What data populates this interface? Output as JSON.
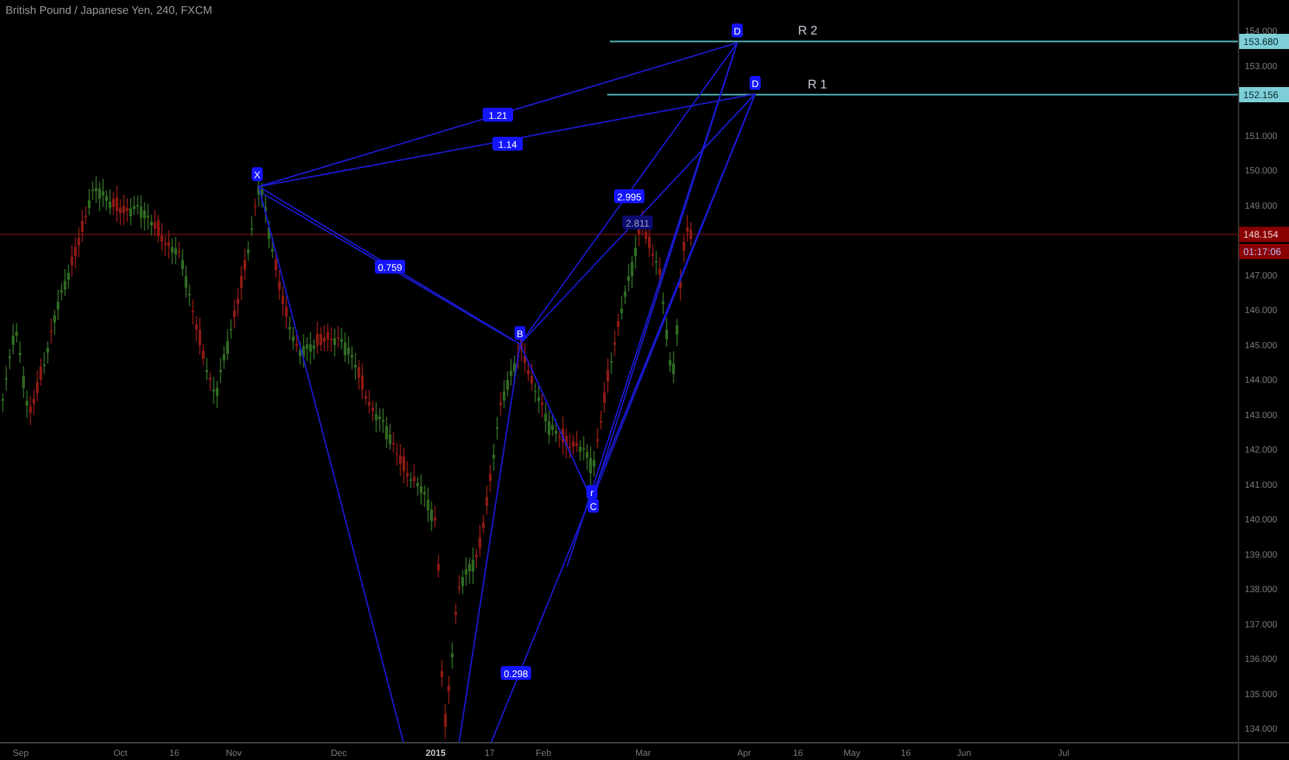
{
  "header": {
    "title": "British Pound / Japanese Yen, 240, FXCM"
  },
  "price_axis": {
    "ticks": [
      "154.000",
      "153.000",
      "151.000",
      "150.000",
      "149.000",
      "147.000",
      "146.000",
      "145.000",
      "144.000",
      "143.000",
      "142.000",
      "141.000",
      "140.000",
      "139.000",
      "138.000",
      "137.000",
      "136.000",
      "135.000",
      "134.000"
    ],
    "tags": [
      {
        "kind": "level",
        "text": "153.680"
      },
      {
        "kind": "level",
        "text": "152.156"
      },
      {
        "kind": "last",
        "text": "148.154"
      },
      {
        "kind": "countdown",
        "text": "01:17:06"
      }
    ]
  },
  "time_axis": {
    "labels": [
      {
        "text": "Sep",
        "bold": false
      },
      {
        "text": "Oct",
        "bold": false
      },
      {
        "text": "16",
        "bold": false
      },
      {
        "text": "Nov",
        "bold": false
      },
      {
        "text": "Dec",
        "bold": false
      },
      {
        "text": "2015",
        "bold": true
      },
      {
        "text": "17",
        "bold": false
      },
      {
        "text": "Feb",
        "bold": false
      },
      {
        "text": "Mar",
        "bold": false
      },
      {
        "text": "Apr",
        "bold": false
      },
      {
        "text": "16",
        "bold": false
      },
      {
        "text": "May",
        "bold": false
      },
      {
        "text": "16",
        "bold": false
      },
      {
        "text": "Jun",
        "bold": false
      },
      {
        "text": "Jul",
        "bold": false
      }
    ]
  },
  "pattern": {
    "points": [
      "X",
      "B",
      "r",
      "C",
      "D",
      "D"
    ],
    "ratios": [
      {
        "text": "1.21",
        "dimmed": false
      },
      {
        "text": "1.14",
        "dimmed": false
      },
      {
        "text": "0.759",
        "dimmed": false
      },
      {
        "text": "2.995",
        "dimmed": false
      },
      {
        "text": "2.811",
        "dimmed": true
      },
      {
        "text": "0.298",
        "dimmed": false
      }
    ]
  },
  "levels": [
    {
      "label": "R 2"
    },
    {
      "label": "R 1"
    }
  ]
}
